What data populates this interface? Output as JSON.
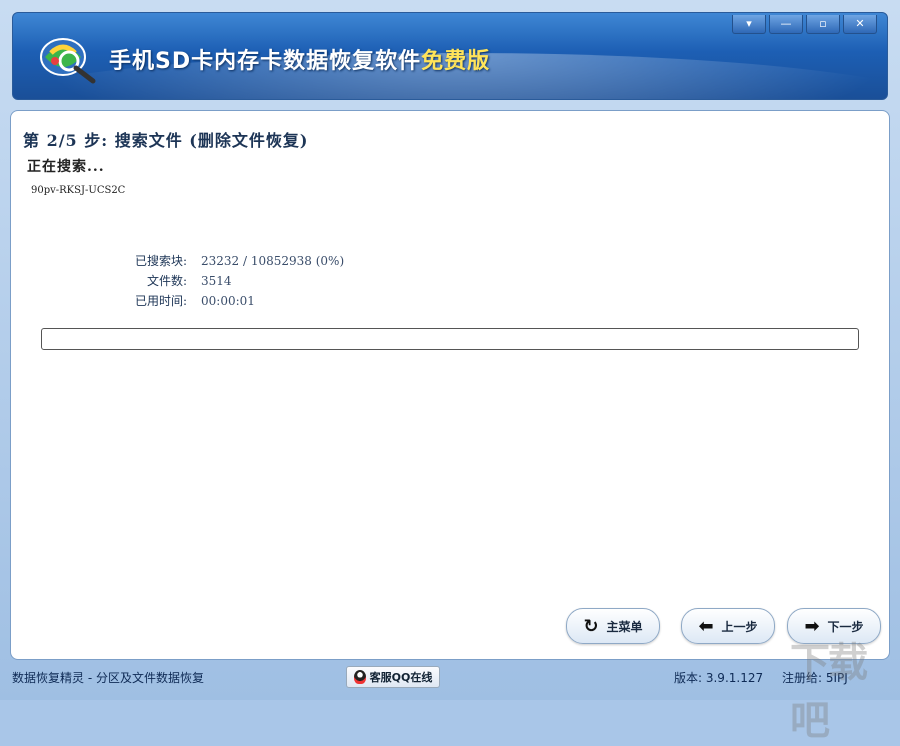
{
  "app": {
    "title_main": "手机SD卡内存卡数据恢复软件",
    "title_free": "免费版"
  },
  "window_controls": {
    "menu": "▾",
    "minimize": "—",
    "maximize": "▫",
    "close": "✕"
  },
  "step": {
    "title": "第 2/5 步: 搜索文件 (删除文件恢复)",
    "status": "正在搜索...",
    "current_item": "90pv-RKSJ-UCS2C"
  },
  "stats": {
    "blocks_label": "已搜索块:",
    "blocks_value": "23232 / 10852938 (0%)",
    "files_label": "文件数:",
    "files_value": "3514",
    "time_label": "已用时间:",
    "time_value": "00:00:01"
  },
  "progress": {
    "percent": 0
  },
  "buttons": {
    "main_menu": "主菜单",
    "prev": "上一步",
    "next": "下一步"
  },
  "icons": {
    "main_menu": "refresh-icon",
    "prev": "arrow-left-icon",
    "next": "arrow-right-icon"
  },
  "footer": {
    "app_desc": "数据恢复精灵 - 分区及文件数据恢复",
    "qq_label": "客服QQ在线",
    "version": "版本: 3.9.1.127",
    "registered": "注册给: 5IPJ"
  },
  "watermark": "下载吧"
}
